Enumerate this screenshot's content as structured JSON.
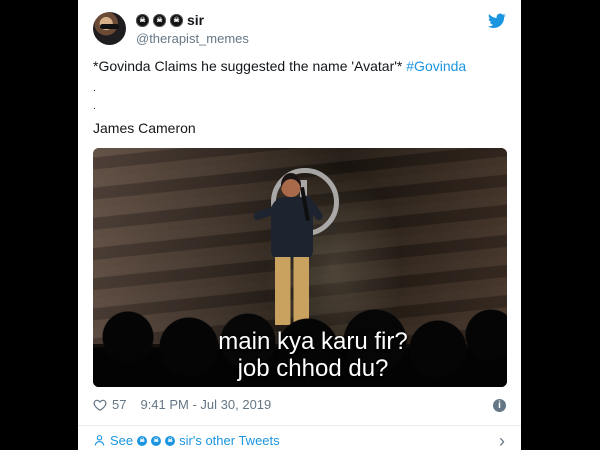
{
  "tweet": {
    "author": {
      "display_name": "sir",
      "handle": "@therapist_memes",
      "emoji_badges": [
        "☠",
        "☠",
        "☠"
      ]
    },
    "text": {
      "line1_prefix": "*Govinda Claims he suggested the name 'Avatar'* ",
      "hashtag": "#Govinda",
      "dot1": ".",
      "dot2": ".",
      "signature": "James Cameron"
    },
    "media": {
      "caption": "main kya karu fir?\njob chhod du?"
    },
    "stats": {
      "likes": "57",
      "time": "9:41 PM - Jul 30, 2019"
    },
    "footer": {
      "see_label": "See",
      "other_tweets_label": "sir's other Tweets",
      "emoji_badges": [
        "☠",
        "☠",
        "☠"
      ]
    },
    "icons": {
      "twitter": "twitter-bird-icon",
      "heart": "heart-icon",
      "info": "info-icon",
      "user": "user-icon",
      "chevron": "chevron-right-icon",
      "info_glyph": "i",
      "chevron_glyph": "›"
    },
    "colors": {
      "twitter_blue": "#1b95e0",
      "text_dark": "#14171a",
      "muted_gray": "#657786",
      "border": "#e6ecf0"
    }
  }
}
